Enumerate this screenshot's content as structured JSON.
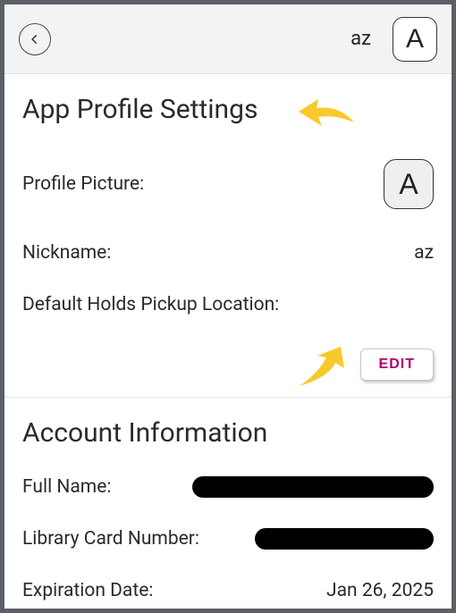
{
  "header": {
    "user_short": "az",
    "avatar_letter": "A"
  },
  "profile": {
    "title": "App Profile Settings",
    "picture_label": "Profile Picture:",
    "picture_letter": "A",
    "nickname_label": "Nickname:",
    "nickname_value": "az",
    "pickup_label": "Default Holds Pickup Location:",
    "pickup_value": "",
    "edit_label": "EDIT"
  },
  "account": {
    "title": "Account Information",
    "fullname_label": "Full Name:",
    "card_label": "Library Card Number:",
    "expiration_label": "Expiration Date:",
    "expiration_value": "Jan 26, 2025"
  }
}
